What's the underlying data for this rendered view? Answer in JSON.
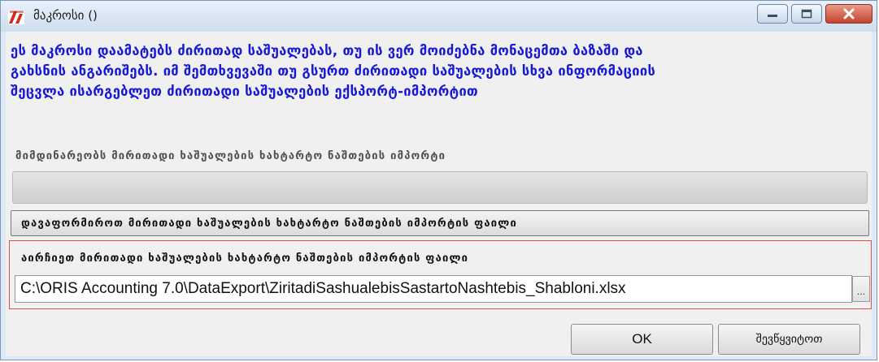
{
  "window": {
    "title": "მაკროსი ()",
    "accent_color": "#1717d6",
    "highlight_border_color": "#e0504a",
    "controls": {
      "minimize_icon": "minimize-icon",
      "maximize_icon": "maximize-icon",
      "close_icon": "close-icon"
    }
  },
  "info": {
    "line1": "ეს მაკროსი დაამატებს ძირითად საშუალებას, თუ ის ვერ მოიძებნა მონაცემთა ბაზაში და",
    "line2": "გახსნის ანგარიშებს. იმ შემთხვევაში თუ გსურთ ძირითადი საშუალების სხვა ინფორმაციის",
    "line3": "შეცვლა ისარგებლეთ ძირითადი საშუალების ექსპორტ-იმპორტით"
  },
  "progress": {
    "label": "მიმდინარეობს მირითადი ხაშუალების ხახტარტო ნაშთების იმპორტი",
    "value": 0
  },
  "template_button": {
    "label": "დავაფორმიროთ მირითადი ხაშუალების ხახტარტო ნაშთების იმპორტის ფაილი"
  },
  "file_group": {
    "label": "აირჩიეთ მირითადი ხაშუალების ხახტარტო ნაშთების იმპორტის ფაილი",
    "path": "C:\\ORIS Accounting 7.0\\DataExport\\ZiritadiSashualebisSastartoNashtebis_Shabloni.xlsx",
    "browse_label": "..."
  },
  "buttons": {
    "ok_label": "OK",
    "cancel_label": "შევწყვიტოთ"
  }
}
